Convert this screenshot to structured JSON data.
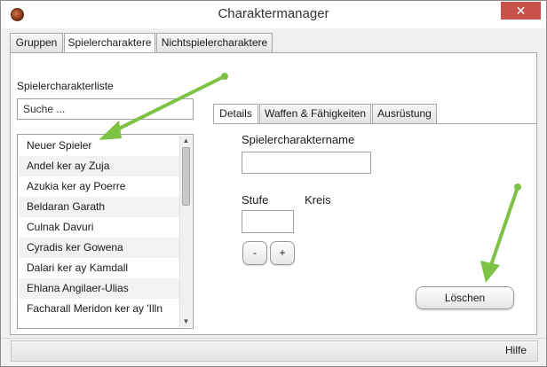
{
  "window": {
    "title": "Charaktermanager",
    "close_glyph": "✕",
    "app_icon": "app-logo-icon"
  },
  "top_tabs": [
    {
      "label": "Gruppen",
      "active": false
    },
    {
      "label": "Spielercharaktere",
      "active": true
    },
    {
      "label": "Nichtspielercharaktere",
      "active": false
    }
  ],
  "list_panel": {
    "label": "Spielercharakterliste",
    "search_placeholder": "Suche ...",
    "items": [
      "Neuer Spieler",
      "Andel ker ay Zuja",
      "Azukia ker ay Poerre",
      "Beldaran Garath",
      "Culnak Davuri",
      "Cyradis ker Gowena",
      "Dalari ker ay Kamdall",
      "Ehlana Angilaer-Ulias",
      "Facharall Meridon ker ay 'Illn"
    ]
  },
  "inner_tabs": [
    {
      "label": "Details",
      "active": true
    },
    {
      "label": "Waffen & Fähigkeiten",
      "active": false
    },
    {
      "label": "Ausrüstung",
      "active": false
    }
  ],
  "details": {
    "name_label": "Spielercharaktername",
    "name_value": "",
    "level_label": "Stufe",
    "level_value": "",
    "circle_label": "Kreis",
    "minus_label": "-",
    "plus_label": "+",
    "delete_label": "Löschen"
  },
  "statusbar": {
    "help_label": "Hilfe"
  },
  "colors": {
    "close_button": "#c7504b",
    "annotation_arrow": "#7dc242"
  }
}
